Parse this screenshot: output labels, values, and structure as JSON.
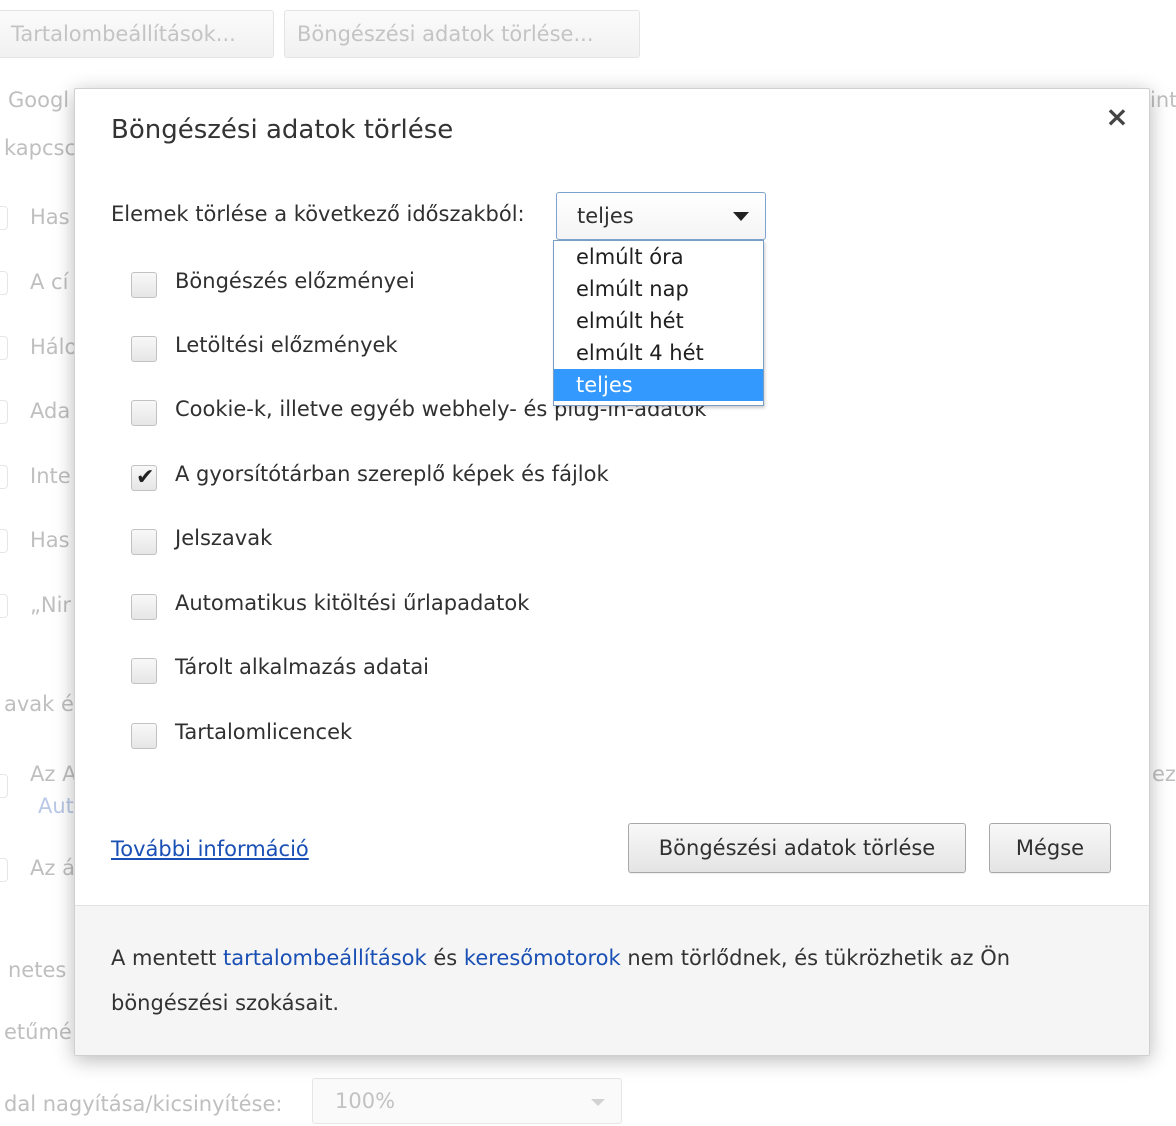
{
  "background": {
    "buttons": [
      "Tartalombeállítások...",
      "Böngészési adatok törlése..."
    ],
    "fragments": {
      "google": "Googl",
      "kapcs": "kapcsc",
      "int": "int",
      "row1": "Has",
      "row2": "A cí",
      "row3": "Hálo",
      "row4": "Ada",
      "row5": "Inte",
      "row6": "Has",
      "row7": "„Nir",
      "passwords": "avak é",
      "az1": "Az A",
      "aut": "Aut",
      "ez": "ez",
      "az2": "Az á",
      "netes": "netes",
      "betume": "etűmé",
      "zoom_label": "dal nagyítása/kicsinyítése:",
      "zoom_value": "100%"
    }
  },
  "dialog": {
    "title": "Böngészési adatok törlése",
    "close_icon": "×",
    "period_label": "Elemek törlése a következő időszakból:",
    "period_value": "teljes",
    "period_options": [
      "elmúlt óra",
      "elmúlt nap",
      "elmúlt hét",
      "elmúlt 4 hét",
      "teljes"
    ],
    "period_selected_index": 4,
    "options": [
      {
        "label": "Böngészés előzményei",
        "checked": false
      },
      {
        "label": "Letöltési előzmények",
        "checked": false
      },
      {
        "label": "Cookie-k, illetve egyéb webhely- és plug-in-adatok",
        "checked": false
      },
      {
        "label": "A gyorsítótárban szereplő képek és fájlok",
        "checked": true
      },
      {
        "label": "Jelszavak",
        "checked": false
      },
      {
        "label": "Automatikus kitöltési űrlapadatok",
        "checked": false
      },
      {
        "label": "Tárolt alkalmazás adatai",
        "checked": false
      },
      {
        "label": "Tartalomlicencek",
        "checked": false
      }
    ],
    "more_info": "További információ",
    "clear_button": "Böngészési adatok törlése",
    "cancel_button": "Mégse",
    "footer": {
      "prefix": "A mentett ",
      "link1": "tartalombeállítások",
      "middle": " és ",
      "link2": "keresőmotorok",
      "suffix": " nem törlődnek, és tükrözhetik az Ön böngészési szokásait."
    }
  }
}
